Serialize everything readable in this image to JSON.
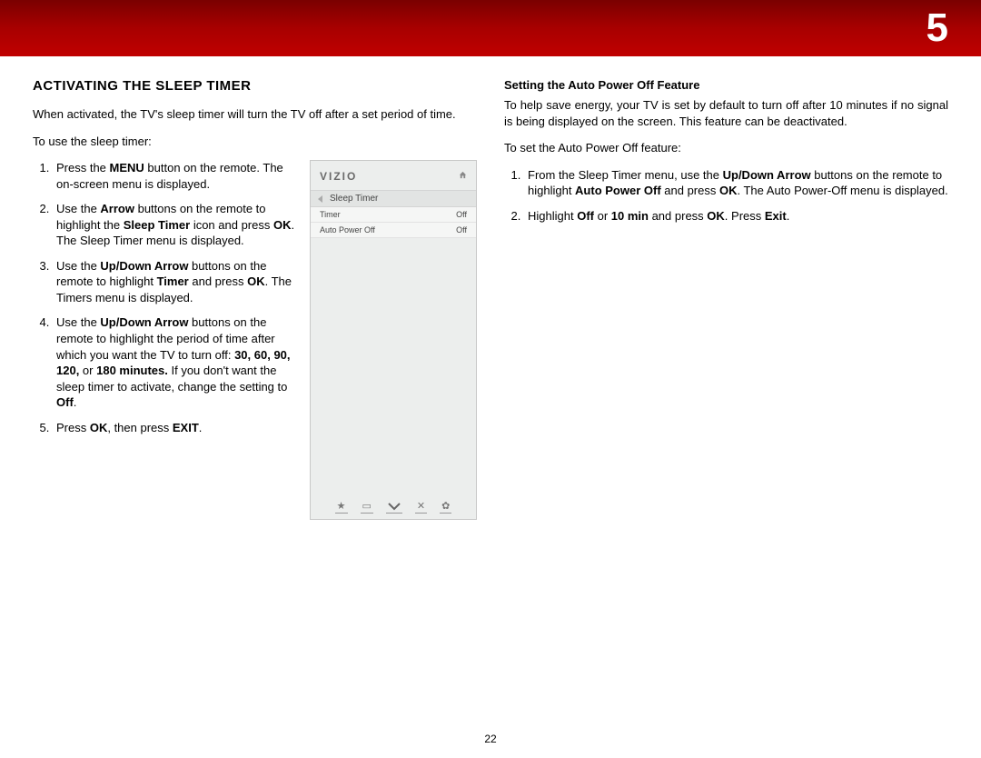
{
  "chapter": "5",
  "page_number": "22",
  "left": {
    "heading": "ACTIVATING THE SLEEP TIMER",
    "intro": "When activated, the TV's sleep timer will turn the TV off after a set period of time.",
    "lead": "To use the sleep timer:",
    "steps_html": [
      "Press the <b>MENU</b> button on the remote. The on-screen menu is displayed.",
      "Use the <b>Arrow</b> buttons on the remote to highlight the <b>Sleep Timer</b> icon and press <b>OK</b>. The Sleep Timer menu is displayed.",
      "Use the <b>Up/Down Arrow</b> buttons on the remote to highlight <b>Timer</b> and press <b>OK</b>. The Timers menu is displayed.",
      "Use the <b>Up/Down Arrow</b> buttons on the remote to highlight the period of time after which you want the TV to turn off: <b>30, 60, 90, 120,</b> or <b>180 minutes.</b> If you don't want the sleep timer to activate, change the setting to <b>Off</b>.",
      "Press <b>OK</b>, then press <b>EXIT</b>."
    ]
  },
  "right": {
    "heading": "Setting the Auto Power Off Feature",
    "intro": "To help save energy, your TV is set by default to turn off after 10 minutes if no signal is being displayed on the screen. This feature can be deactivated.",
    "lead": "To set the Auto Power Off feature:",
    "steps_html": [
      "From the Sleep Timer menu, use the <b>Up/Down Arrow</b> buttons on the remote to highlight <b>Auto Power Off</b> and press <b>OK</b>. The Auto Power-Off menu is displayed.",
      "Highlight <b>Off</b> or <b>10 min</b> and press <b>OK</b>. Press <b>Exit</b>."
    ]
  },
  "panel": {
    "brand": "VIZIO",
    "crumb": "Sleep Timer",
    "rows": [
      {
        "label": "Timer",
        "value": "Off"
      },
      {
        "label": "Auto Power Off",
        "value": "Off"
      }
    ]
  }
}
